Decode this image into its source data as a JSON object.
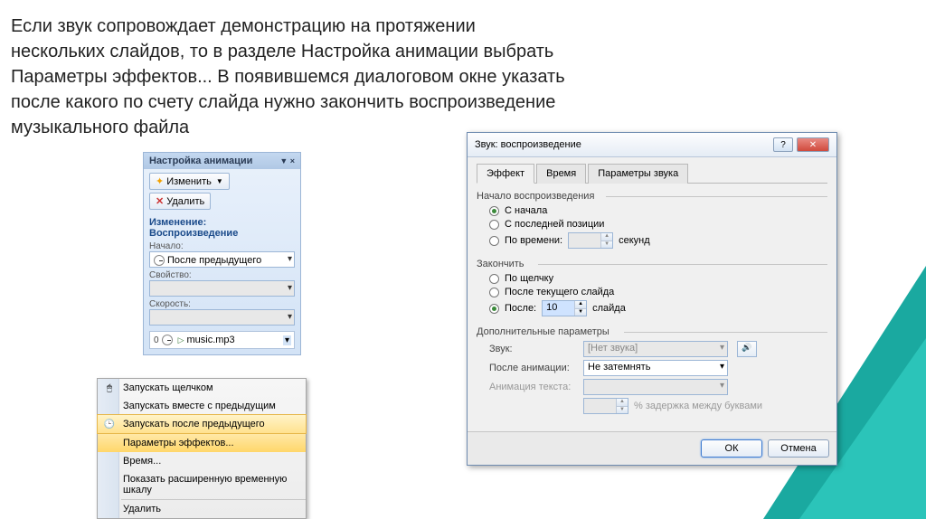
{
  "description": "Если звук сопровождает демонстрацию на протяжении нескольких слайдов, то в разделе Настройка анимации выбрать Параметры эффектов... В появившемся диалоговом окне указать после какого по счету слайда нужно закончить воспроизведение музыкального файла",
  "panel": {
    "title": "Настройка анимации",
    "btn_change": "Изменить",
    "btn_delete": "Удалить",
    "section_change": "Изменение: Воспроизведение",
    "label_start": "Начало:",
    "start_value": "После предыдущего",
    "label_property": "Свойство:",
    "label_speed": "Скорость:",
    "item_num": "0",
    "item_name": "music.mp3"
  },
  "menu": {
    "start_click": "Запускать щелчком",
    "start_with": "Запускать вместе с предыдущим",
    "start_after": "Запускать после предыдущего",
    "effect_options": "Параметры эффектов...",
    "timing": "Время...",
    "show_timeline": "Показать расширенную временную шкалу",
    "remove": "Удалить"
  },
  "dialog": {
    "title": "Звук: воспроизведение",
    "tabs": {
      "effect": "Эффект",
      "timing": "Время",
      "sound": "Параметры звука"
    },
    "group_start": "Начало воспроизведения",
    "r_from_start": "С начала",
    "r_from_last": "С последней позиции",
    "r_by_time": "По времени:",
    "seconds": "секунд",
    "group_end": "Закончить",
    "r_on_click": "По щелчку",
    "r_after_current": "После текущего слайда",
    "r_after": "После:",
    "after_value": "10",
    "slides": "слайда",
    "group_extra": "Дополнительные параметры",
    "l_sound": "Звук:",
    "v_sound": "[Нет звука]",
    "l_after_anim": "После анимации:",
    "v_after_anim": "Не затемнять",
    "l_text_anim": "Анимация текста:",
    "delay_text": "% задержка между буквами",
    "ok": "ОК",
    "cancel": "Отмена"
  }
}
